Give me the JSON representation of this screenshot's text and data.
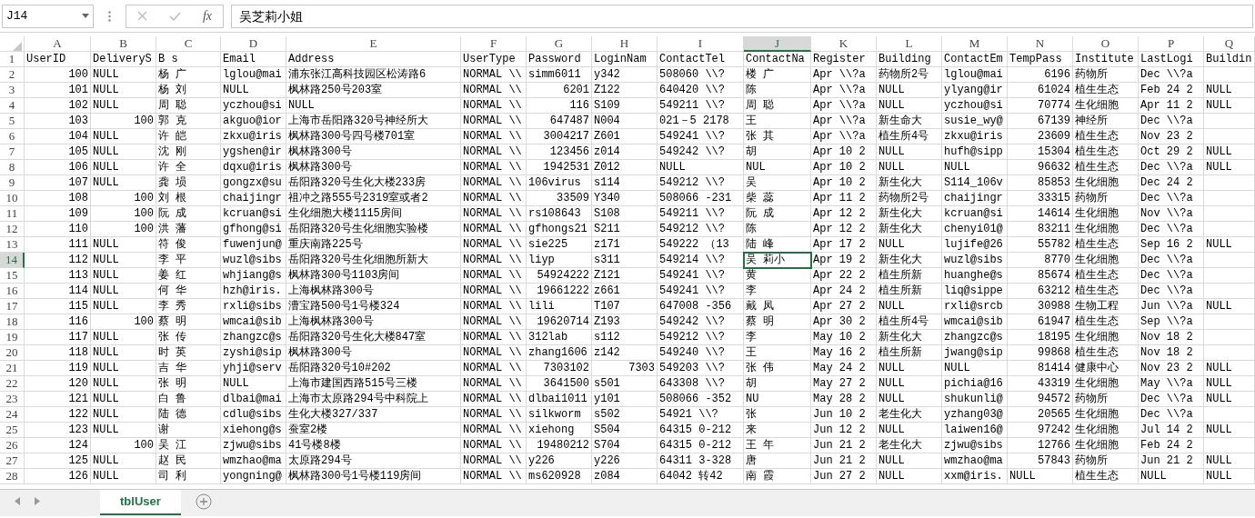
{
  "formula_bar": {
    "name_box": "J14",
    "function_label": "fx",
    "formula": "吴芝莉小姐"
  },
  "columns": [
    {
      "label": "A",
      "selected": false
    },
    {
      "label": "B",
      "selected": false
    },
    {
      "label": "C",
      "selected": false
    },
    {
      "label": "D",
      "selected": false
    },
    {
      "label": "E",
      "selected": false
    },
    {
      "label": "F",
      "selected": false
    },
    {
      "label": "G",
      "selected": false
    },
    {
      "label": "H",
      "selected": false
    },
    {
      "label": "I",
      "selected": false
    },
    {
      "label": "J",
      "selected": true
    },
    {
      "label": "K",
      "selected": false
    },
    {
      "label": "L",
      "selected": false
    },
    {
      "label": "M",
      "selected": false
    },
    {
      "label": "N",
      "selected": false
    },
    {
      "label": "O",
      "selected": false
    },
    {
      "label": "P",
      "selected": false
    },
    {
      "label": "Q",
      "selected": false
    }
  ],
  "rows": [
    {
      "label": "1",
      "selected": false,
      "cells": [
        "UserID",
        "DeliveryS",
        "B s",
        "Email",
        "Address",
        "UserType",
        "Password",
        "LoginNam",
        "ContactTel",
        "ContactNa",
        "Register",
        "Building",
        "ContactEm",
        "TempPass",
        "Institute",
        "LastLogi",
        "Buildin"
      ]
    },
    {
      "label": "2",
      "selected": false,
      "cells": [
        {
          "text": "100",
          "number": true
        },
        "NULL",
        "杨 广",
        "lglou@mai",
        "浦东张江高科技园区松涛路6",
        "NORMAL \\\\",
        "simm6011",
        "y342",
        "508060 \\\\?",
        "楼 广",
        "Apr \\\\?a",
        "药物所2号",
        "lglou@mai",
        {
          "text": "6196",
          "number": true
        },
        "药物所",
        "Dec \\\\?a",
        null
      ]
    },
    {
      "label": "3",
      "selected": false,
      "cells": [
        {
          "text": "101",
          "number": true
        },
        "NULL",
        "杨 刘",
        "NULL",
        "枫林路250号203室",
        "NORMAL \\\\",
        {
          "text": "6201",
          "number": true
        },
        "Z122",
        "640420 \\\\?",
        "陈",
        "Apr \\\\?a",
        "NULL",
        "ylyang@ir",
        {
          "text": "61024",
          "number": true
        },
        "植生生态",
        "Feb 24 2",
        "NULL"
      ]
    },
    {
      "label": "4",
      "selected": false,
      "cells": [
        {
          "text": "102",
          "number": true
        },
        "NULL",
        "周 聪",
        "yczhou@si",
        "NULL",
        "NORMAL \\\\",
        {
          "text": "116",
          "number": true
        },
        "S109",
        "549211 \\\\?",
        "周 聪",
        "Apr \\\\?a",
        "NULL",
        "yczhou@si",
        {
          "text": "70774",
          "number": true
        },
        "生化细胞",
        "Apr 11 2",
        "NULL"
      ]
    },
    {
      "label": "5",
      "selected": false,
      "cells": [
        {
          "text": "103",
          "number": true
        },
        {
          "text": "100",
          "number": true
        },
        "郭 克",
        "akguo@ior",
        "上海市岳阳路320号神经所大",
        "NORMAL \\\\",
        {
          "text": "647487",
          "number": true
        },
        "N004",
        "021－5 2178",
        "王",
        "Apr \\\\?a",
        "新生命大",
        "susie_wy@",
        {
          "text": "67139",
          "number": true
        },
        "神经所",
        "Dec \\\\?a",
        null
      ]
    },
    {
      "label": "6",
      "selected": false,
      "cells": [
        {
          "text": "104",
          "number": true
        },
        "NULL",
        "许 皑",
        "zkxu@iris",
        "枫林路300号四号楼701室",
        "NORMAL \\\\",
        {
          "text": "3004217",
          "number": true
        },
        "Z601",
        "549241 \\\\?",
        "张 其",
        "Apr \\\\?a",
        "植生所4号",
        "zkxu@iris",
        {
          "text": "23609",
          "number": true
        },
        "植生生态",
        "Nov 23 2",
        null
      ]
    },
    {
      "label": "7",
      "selected": false,
      "cells": [
        {
          "text": "105",
          "number": true
        },
        "NULL",
        "沈 刚",
        "ygshen@ir",
        "枫林路300号",
        "NORMAL \\\\",
        {
          "text": "123456",
          "number": true
        },
        "z014",
        "549242 \\\\?",
        "胡",
        "Apr 10 2",
        "NULL",
        "hufh@sipp",
        {
          "text": "15304",
          "number": true
        },
        "植生生态",
        "Oct 29 2",
        "NULL"
      ]
    },
    {
      "label": "8",
      "selected": false,
      "cells": [
        {
          "text": "106",
          "number": true
        },
        "NULL",
        "许 全",
        "dqxu@iris",
        "枫林路300号",
        "NORMAL \\\\",
        {
          "text": "1942531",
          "number": true
        },
        "Z012",
        "NULL",
        "NUL",
        "Apr 10 2",
        "NULL",
        "NULL",
        {
          "text": "96632",
          "number": true
        },
        "植生生态",
        "Dec \\\\?a",
        "NULL"
      ]
    },
    {
      "label": "9",
      "selected": false,
      "cells": [
        {
          "text": "107",
          "number": true
        },
        "NULL",
        "龚 埙",
        "gongzx@su",
        "岳阳路320号生化大楼233房",
        "NORMAL \\\\",
        "106virus",
        "s114",
        "549212 \\\\?",
        "吴",
        "Apr 10 2",
        "新生化大",
        "S114_106v",
        {
          "text": "85853",
          "number": true
        },
        "生化细胞",
        "Dec 24 2",
        null
      ]
    },
    {
      "label": "10",
      "selected": false,
      "cells": [
        {
          "text": "108",
          "number": true
        },
        {
          "text": "100",
          "number": true
        },
        "刘 根",
        "chaijingr",
        "祖冲之路555号2319室或者2",
        "NORMAL \\\\",
        {
          "text": "33509",
          "number": true
        },
        "Y340",
        "508066 -231",
        "柴 蕊",
        "Apr 11 2",
        "药物所2号",
        "chaijingr",
        {
          "text": "33315",
          "number": true
        },
        "药物所",
        "Dec \\\\?a",
        null
      ]
    },
    {
      "label": "11",
      "selected": false,
      "cells": [
        {
          "text": "109",
          "number": true
        },
        {
          "text": "100",
          "number": true
        },
        "阮 成",
        "kcruan@si",
        "生化细胞大楼1115房间",
        "NORMAL \\\\",
        "rs108643",
        "S108",
        "549211 \\\\?",
        "阮 成",
        "Apr 12 2",
        "新生化大",
        "kcruan@si",
        {
          "text": "14614",
          "number": true
        },
        "生化细胞",
        "Nov \\\\?a",
        null
      ]
    },
    {
      "label": "12",
      "selected": false,
      "cells": [
        {
          "text": "110",
          "number": true
        },
        {
          "text": "100",
          "number": true
        },
        "洪 藩",
        "gfhong@si",
        "岳阳路320号生化细胞实验楼",
        "NORMAL \\\\",
        "gfhongs21",
        "S211",
        "549212 \\\\?",
        "陈",
        "Apr 12 2",
        "新生化大",
        "chenyi01@",
        {
          "text": "83211",
          "number": true
        },
        "生化细胞",
        "Dec \\\\?a",
        null
      ]
    },
    {
      "label": "13",
      "selected": false,
      "cells": [
        {
          "text": "111",
          "number": true
        },
        "NULL",
        "符 俊",
        "fuwenjun@",
        "重庆南路225号",
        "NORMAL \\\\",
        "sie225",
        "z171",
        "549222 （13",
        "陆 峰",
        "Apr 17 2",
        "NULL",
        "lujife@26",
        {
          "text": "55782",
          "number": true
        },
        "植生生态",
        "Sep 16 2",
        "NULL"
      ]
    },
    {
      "label": "14",
      "selected": true,
      "cells": [
        {
          "text": "112",
          "number": true
        },
        "NULL",
        "李 平",
        "wuzl@sibs",
        "岳阳路320号生化细胞所新大",
        "NORMAL \\\\",
        "liyp",
        "s311",
        "549214 \\\\?",
        {
          "text": "吴 莉小",
          "selected": true
        },
        "Apr 19 2",
        "新生化大",
        "wuzl@sibs",
        {
          "text": "8770",
          "number": true
        },
        "生化细胞",
        "Dec \\\\?a",
        null
      ]
    },
    {
      "label": "15",
      "selected": false,
      "cells": [
        {
          "text": "113",
          "number": true
        },
        "NULL",
        "姜 红",
        "whjiang@s",
        "枫林路300号1103房间",
        "NORMAL \\\\",
        {
          "text": "54924222",
          "number": true
        },
        "Z121",
        "549241 \\\\?",
        "黄",
        "Apr 22 2",
        "植生所新",
        "huanghe@s",
        {
          "text": "85674",
          "number": true
        },
        "植生生态",
        "Dec \\\\?a",
        null
      ]
    },
    {
      "label": "16",
      "selected": false,
      "cells": [
        {
          "text": "114",
          "number": true
        },
        "NULL",
        "何 华",
        "hzh@iris.",
        "上海枫林路300号",
        "NORMAL \\\\",
        {
          "text": "19661222",
          "number": true
        },
        "z661",
        "549241 \\\\?",
        "李",
        "Apr 24 2",
        "植生所新",
        "liq@sippe",
        {
          "text": "63212",
          "number": true
        },
        "植生生态",
        "Dec \\\\?a",
        null
      ]
    },
    {
      "label": "17",
      "selected": false,
      "cells": [
        {
          "text": "115",
          "number": true
        },
        "NULL",
        "李 秀",
        "rxli@sibs",
        "漕宝路500号1号楼324",
        "NORMAL \\\\",
        "lili",
        "T107",
        "647008 -356",
        "戴 凤",
        "Apr 27 2",
        "NULL",
        "rxli@srcb",
        {
          "text": "30988",
          "number": true
        },
        "生物工程",
        "Jun \\\\?a",
        "NULL"
      ]
    },
    {
      "label": "18",
      "selected": false,
      "cells": [
        {
          "text": "116",
          "number": true
        },
        {
          "text": "100",
          "number": true
        },
        "蔡 明",
        "wmcai@sib",
        "上海枫林路300号",
        "NORMAL \\\\",
        {
          "text": "19620714",
          "number": true
        },
        "Z193",
        "549242 \\\\?",
        "蔡 明",
        "Apr 30 2",
        "植生所4号",
        "wmcai@sib",
        {
          "text": "61947",
          "number": true
        },
        "植生生态",
        "Sep \\\\?a",
        null
      ]
    },
    {
      "label": "19",
      "selected": false,
      "cells": [
        {
          "text": "117",
          "number": true
        },
        "NULL",
        "张 传",
        "zhangzc@s",
        "岳阳路320号生化大楼847室",
        "NORMAL \\\\",
        "312lab",
        "s112",
        "549212 \\\\?",
        "李",
        "May 10 2",
        "新生化大",
        "zhangzc@s",
        {
          "text": "18195",
          "number": true
        },
        "生化细胞",
        "Nov 18 2",
        null
      ]
    },
    {
      "label": "20",
      "selected": false,
      "cells": [
        {
          "text": "118",
          "number": true
        },
        "NULL",
        "时 英",
        "zyshi@sip",
        "枫林路300号",
        "NORMAL \\\\",
        "zhang1606",
        "z142",
        "549240 \\\\?",
        "王",
        "May 16 2",
        "植生所新",
        "jwang@sip",
        {
          "text": "99868",
          "number": true
        },
        "植生生态",
        "Nov 18 2",
        null
      ]
    },
    {
      "label": "21",
      "selected": false,
      "cells": [
        {
          "text": "119",
          "number": true
        },
        "NULL",
        "吉 华",
        "yhji@serv",
        "岳阳路320号10#202",
        "NORMAL \\\\",
        {
          "text": "7303102",
          "number": true
        },
        {
          "text": "7303",
          "number": true
        },
        "549203 \\\\?",
        "张 伟",
        "May 24 2",
        "NULL",
        "NULL",
        {
          "text": "81414",
          "number": true
        },
        "健康中心",
        "Nov 23 2",
        "NULL"
      ]
    },
    {
      "label": "22",
      "selected": false,
      "cells": [
        {
          "text": "120",
          "number": true
        },
        "NULL",
        "张 明",
        "NULL",
        "上海市建国西路515号三楼",
        "NORMAL \\\\",
        {
          "text": "3641500",
          "number": true
        },
        "s501",
        "643308 \\\\?",
        "胡",
        "May 27 2",
        "NULL",
        "pichia@16",
        {
          "text": "43319",
          "number": true
        },
        "生化细胞",
        "May \\\\?a",
        "NULL"
      ]
    },
    {
      "label": "23",
      "selected": false,
      "cells": [
        {
          "text": "121",
          "number": true
        },
        "NULL",
        "白 鲁",
        "dlbai@mai",
        "上海市太原路294号中科院上",
        "NORMAL \\\\",
        "dlbai1011",
        "y101",
        "508066 -352",
        "NU",
        "May 28 2",
        "NULL",
        "shukunli@",
        {
          "text": "94572",
          "number": true
        },
        "药物所",
        "Dec \\\\?a",
        "NULL"
      ]
    },
    {
      "label": "24",
      "selected": false,
      "cells": [
        {
          "text": "122",
          "number": true
        },
        "NULL",
        "陆 德",
        "cdlu@sibs",
        "生化大楼327/337",
        "NORMAL \\\\",
        "silkworm",
        "s502",
        "54921 \\\\?",
        "张",
        "Jun 10 2",
        "老生化大",
        "yzhang03@",
        {
          "text": "20565",
          "number": true
        },
        "生化细胞",
        "Dec \\\\?a",
        null
      ]
    },
    {
      "label": "25",
      "selected": false,
      "cells": [
        {
          "text": "123",
          "number": true
        },
        "NULL",
        "谢",
        "xiehong@s",
        "蚕室2楼",
        "NORMAL \\\\",
        "xiehong",
        "S504",
        "64315 0-212",
        "来",
        "Jun 12 2",
        "NULL",
        "laiwen16@",
        {
          "text": "97242",
          "number": true
        },
        "生化细胞",
        "Jul 14 2",
        "NULL"
      ]
    },
    {
      "label": "26",
      "selected": false,
      "cells": [
        {
          "text": "124",
          "number": true
        },
        {
          "text": "100",
          "number": true
        },
        "吴 江",
        "zjwu@sibs",
        "41号楼8楼",
        "NORMAL \\\\",
        {
          "text": "19480212",
          "number": true
        },
        "S704",
        "64315 0-212",
        "王 年",
        "Jun 21 2",
        "老生化大",
        "zjwu@sibs",
        {
          "text": "12766",
          "number": true
        },
        "生化细胞",
        "Feb 24 2",
        null
      ]
    },
    {
      "label": "27",
      "selected": false,
      "cells": [
        {
          "text": "125",
          "number": true
        },
        "NULL",
        "赵 民",
        "wmzhao@ma",
        "太原路294号",
        "NORMAL \\\\",
        "y226",
        "y226",
        "64311 3-328",
        "唐",
        "Jun 21 2",
        "NULL",
        "wmzhao@ma",
        {
          "text": "57843",
          "number": true
        },
        "药物所",
        "Jun 21 2",
        "NULL"
      ]
    },
    {
      "label": "28",
      "selected": false,
      "cells": [
        {
          "text": "126",
          "number": true
        },
        "NULL",
        "司 利",
        "yongning@",
        "枫林路300号1号楼119房间",
        "NORMAL \\\\",
        "ms620928",
        "z084",
        "64042 转42",
        "南 霞",
        "Jun 27 2",
        "NULL",
        "xxm@iris.",
        "NULL",
        "植生生态",
        "NULL",
        "NULL"
      ]
    }
  ],
  "sheet_tabs": [
    {
      "label": "tblUser",
      "selected": true
    }
  ]
}
